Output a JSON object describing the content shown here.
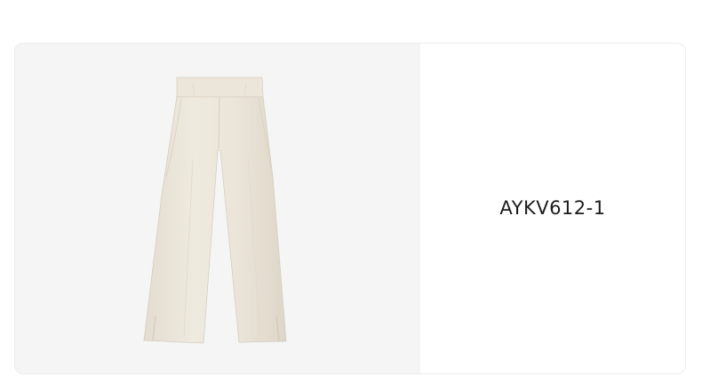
{
  "product": {
    "sku": "AYKV612-1",
    "image_icon": "pants-icon",
    "image_bg_color": "#f5f5f5",
    "garment_color": "#ebe5d9"
  }
}
